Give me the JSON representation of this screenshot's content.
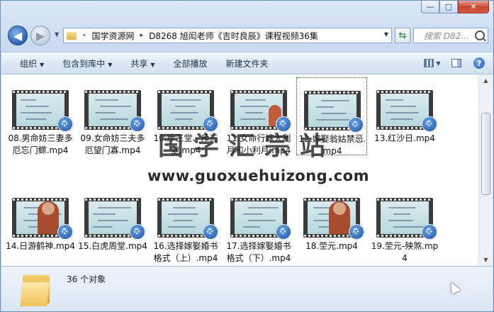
{
  "window": {
    "minimize": "—",
    "maximize": "□",
    "close": "✕"
  },
  "address": {
    "crumbs": [
      "国学资源网",
      "D8268 旭闳老师《吉时良辰》课程视频36集"
    ],
    "prefix": "«",
    "sep": "▸"
  },
  "search": {
    "placeholder": "搜索 D82..."
  },
  "toolbar": {
    "organize": "组织",
    "include_in_library": "包含到库中",
    "share": "共享",
    "play_all": "全部播放",
    "new_folder": "新建文件夹"
  },
  "files": [
    {
      "name": "08.男命妨三妻多厄忘门鳏.mp4",
      "person": false,
      "selected": false
    },
    {
      "name": "09.女命妨三夫多厄望门寡.mp4",
      "person": false,
      "selected": false
    },
    {
      "name": "10.斥三堂、斥三堂.mp4",
      "person": false,
      "selected": false
    },
    {
      "name": "11.女命行嫁大利月和小利月.mp4",
      "person": true,
      "selected": false
    },
    {
      "name": "12.嫁娶翁姑禁忌.mp4",
      "person": false,
      "selected": true
    },
    {
      "name": "13.红沙日.mp4",
      "person": false,
      "selected": false
    },
    {
      "name": "14.日游鹤神.mp4",
      "person": "big",
      "selected": false
    },
    {
      "name": "15.白虎周堂.mp4",
      "person": false,
      "selected": false
    },
    {
      "name": "16.选择嫁娶婚书格式（上）.mp4",
      "person": false,
      "selected": false
    },
    {
      "name": "17.选择嫁娶婚书格式（下）.mp4",
      "person": false,
      "selected": false
    },
    {
      "name": "18.茔元.mp4",
      "person": "big",
      "selected": false
    },
    {
      "name": "19.茔元-殃煞.mp4",
      "person": false,
      "selected": false
    }
  ],
  "watermark": {
    "cn": "国学汇宗站",
    "url": "www.guoxuehuizong.com"
  },
  "status": {
    "count": "36 个对象"
  }
}
